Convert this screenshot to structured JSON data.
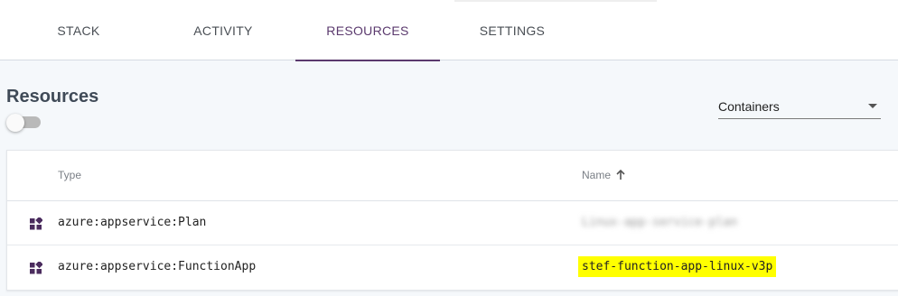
{
  "tabs": [
    {
      "label": "STACK",
      "active": false
    },
    {
      "label": "ACTIVITY",
      "active": false
    },
    {
      "label": "RESOURCES",
      "active": true
    },
    {
      "label": "SETTINGS",
      "active": false
    }
  ],
  "resources": {
    "title": "Resources",
    "toggle_on": false,
    "view_select": {
      "value": "Containers"
    }
  },
  "table": {
    "headers": {
      "type": "Type",
      "name": "Name"
    },
    "sort": {
      "column": "Name",
      "direction": "ascending",
      "icon": "arrow-up-icon"
    },
    "rows": [
      {
        "icon": "resource-icon",
        "type": "azure:appservice:Plan",
        "name": "Linux-app-service-plan",
        "name_redacted": true
      },
      {
        "icon": "resource-icon",
        "type": "azure:appservice:FunctionApp",
        "name": "stef-function-app-linux-v3p",
        "highlighted": true
      }
    ]
  },
  "colors": {
    "accent": "#5b3a6e",
    "resource_icon": "#4b2c5e",
    "highlight": "#ffff00",
    "page_bg": "#f5f8fb"
  }
}
